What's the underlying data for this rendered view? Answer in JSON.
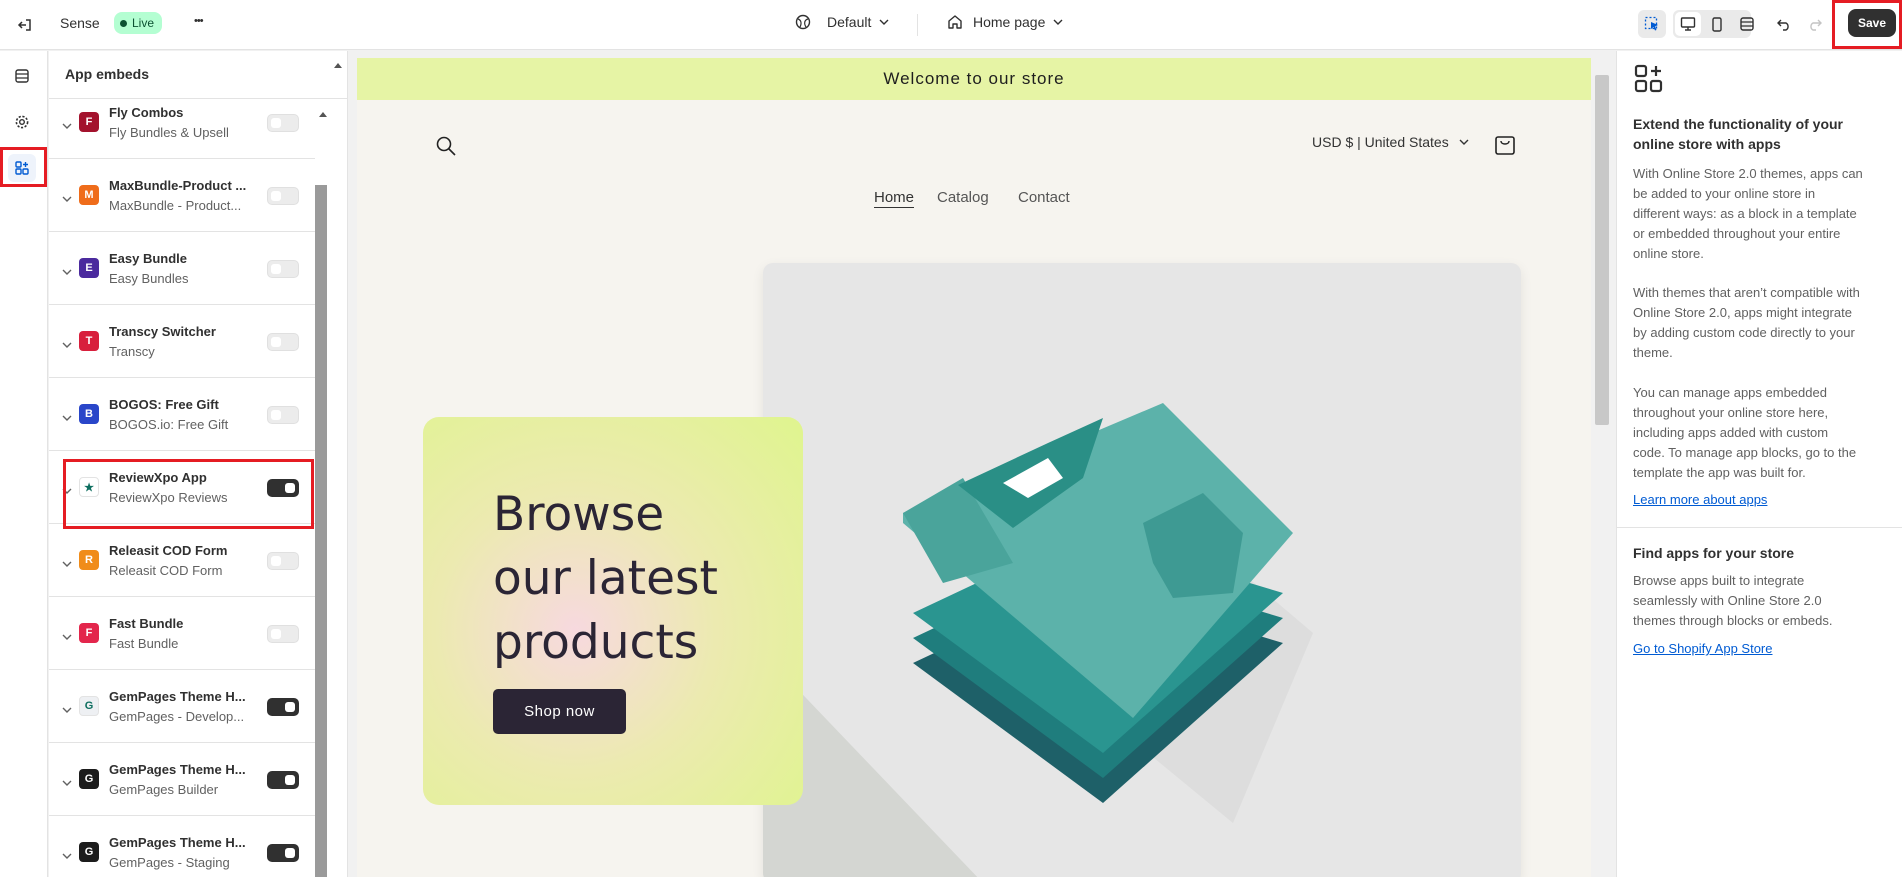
{
  "topbar": {
    "theme_name": "Sense",
    "live_badge": "Live",
    "more_label": "•••",
    "template_select": "Default",
    "page_select": "Home page",
    "save_label": "Save"
  },
  "panel": {
    "title": "App embeds",
    "items": [
      {
        "name": "Fly Combos",
        "subtitle": "Fly Bundles & Upsell",
        "enabled": false,
        "logo_color": "#a3122d",
        "logo_text": "F"
      },
      {
        "name": "MaxBundle-Product ...",
        "subtitle": "MaxBundle - Product...",
        "enabled": false,
        "logo_color": "#ef6c1a",
        "logo_text": "M"
      },
      {
        "name": "Easy Bundle",
        "subtitle": "Easy Bundles",
        "enabled": false,
        "logo_color": "#4b2a9e",
        "logo_text": "E"
      },
      {
        "name": "Transcy Switcher",
        "subtitle": "Transcy",
        "enabled": false,
        "logo_color": "#d81f3c",
        "logo_text": "T"
      },
      {
        "name": "BOGOS: Free Gift",
        "subtitle": "BOGOS.io: Free Gift",
        "enabled": false,
        "logo_color": "#2946c9",
        "logo_text": "B"
      },
      {
        "name": "ReviewXpo App",
        "subtitle": "ReviewXpo Reviews",
        "enabled": true,
        "logo_color": "#ffffff",
        "logo_text": "★"
      },
      {
        "name": "Releasit COD Form",
        "subtitle": "Releasit COD Form",
        "enabled": false,
        "logo_color": "#f08c1a",
        "logo_text": "R"
      },
      {
        "name": "Fast Bundle",
        "subtitle": "Fast Bundle",
        "enabled": false,
        "logo_color": "#e3264c",
        "logo_text": "F"
      },
      {
        "name": "GemPages Theme H...",
        "subtitle": "GemPages - Develop...",
        "enabled": true,
        "logo_color": "#eef0f3",
        "logo_text": "G"
      },
      {
        "name": "GemPages Theme H...",
        "subtitle": "GemPages Builder",
        "enabled": true,
        "logo_color": "#1c1c1c",
        "logo_text": "G"
      },
      {
        "name": "GemPages Theme H...",
        "subtitle": "GemPages - Staging",
        "enabled": true,
        "logo_color": "#1c1c1c",
        "logo_text": "G"
      }
    ]
  },
  "preview": {
    "announcement": "Welcome to our store",
    "currency": "USD $ | United States",
    "nav": [
      "Home",
      "Catalog",
      "Contact"
    ],
    "hero_heading_line1": "Browse",
    "hero_heading_line2": "our latest",
    "hero_heading_line3": "products",
    "hero_button": "Shop now"
  },
  "rightpanel": {
    "heading1_line1": "Extend the functionality of your",
    "heading1_line2": "online store with apps",
    "para1": "With Online Store 2.0 themes, apps can be added to your online store in different ways: as a block in a template or embedded throughout your entire online store.",
    "para2": "With themes that aren’t compatible with Online Store 2.0, apps might integrate by adding custom code directly to your theme.",
    "para3": "You can manage apps embedded throughout your online store here, including apps added with custom code. To manage app blocks, go to the template the app was built for.",
    "link1": "Learn more about apps",
    "heading2": "Find apps for your store",
    "para4": "Browse apps built to integrate seamlessly with Online Store 2.0 themes through blocks or embeds.",
    "link2": "Go to Shopify App Store"
  },
  "colors": {
    "accent_red": "#e51c23",
    "live_green": "#b4fed2",
    "announcement_bg": "#e6f4a5",
    "hero_btn": "#2b2535"
  }
}
